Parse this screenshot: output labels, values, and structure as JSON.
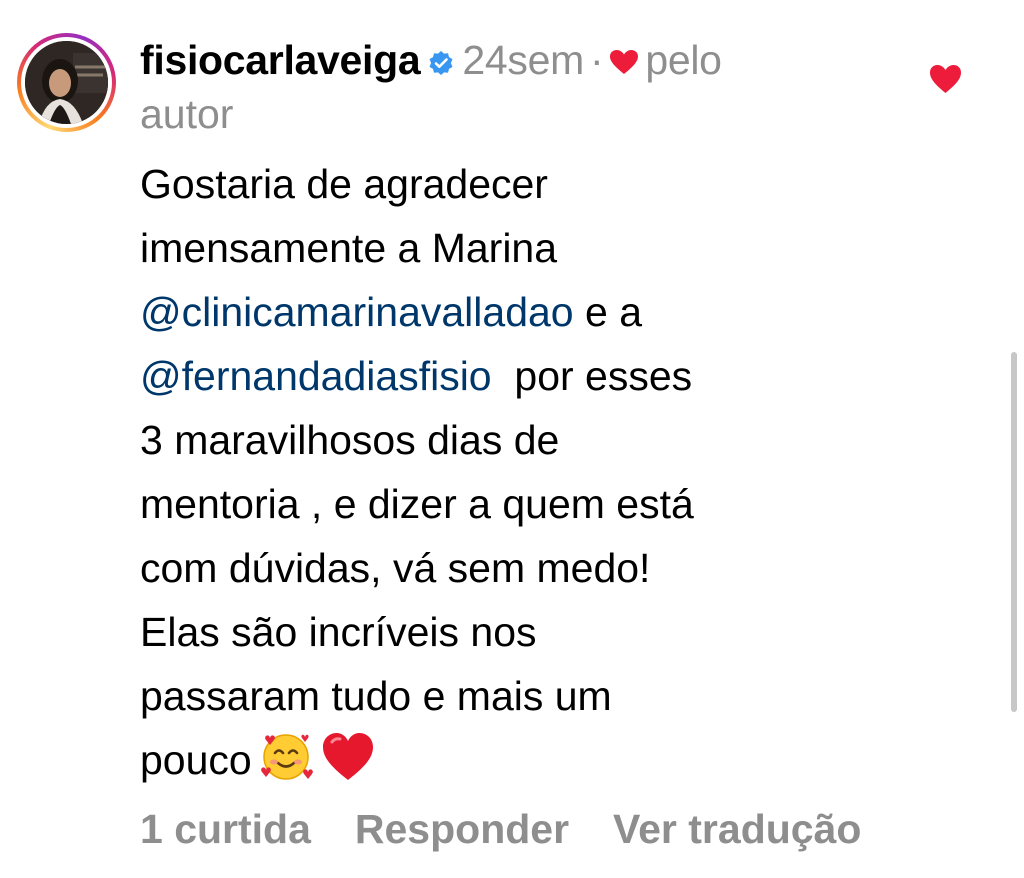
{
  "comment": {
    "username": "fisiocarlaveiga",
    "verified_icon": "verified-badge-icon",
    "time": "24sem",
    "separator": "·",
    "liked_by_author_icon": "heart-icon",
    "liked_by_author_text_1": "pelo",
    "liked_by_author_text_2": "autor",
    "text_lines": [
      "Gostaria de agradecer",
      "imensamente a Marina"
    ],
    "mention_1": "@clinicamarinavalladao",
    "after_mention_1": " e a",
    "mention_2": "@fernandadiasfisio",
    "after_mention_2": "  por esses",
    "more_lines": [
      "3 maravilhosos dias de",
      "mentoria , e dizer a quem está",
      "com dúvidas, vá sem medo!",
      "Elas são incríveis nos",
      "passaram tudo e mais um"
    ],
    "last_line": "pouco",
    "emojis": [
      "smiling-face-with-hearts-emoji",
      "red-heart-emoji"
    ]
  },
  "actions": {
    "likes": "1 curtida",
    "reply": "Responder",
    "translate": "Ver tradução"
  },
  "like_button_icon": "heart-filled-icon",
  "colors": {
    "mention": "#00376b",
    "muted": "#8e8e8e",
    "heart": "#ed1c3b",
    "verified": "#3897f0"
  }
}
